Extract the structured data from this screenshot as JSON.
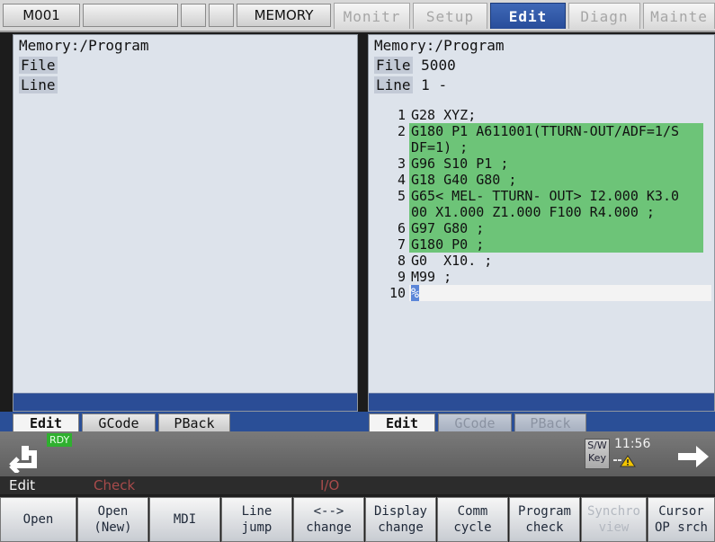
{
  "topbar": {
    "program_no": "M001",
    "mode_text": "MEMORY",
    "tabs": [
      {
        "label": "Monitr",
        "active": false
      },
      {
        "label": "Setup",
        "active": false
      },
      {
        "label": "Edit",
        "active": true
      },
      {
        "label": "Diagn",
        "active": false
      },
      {
        "label": "Mainte",
        "active": false
      }
    ]
  },
  "left_pane": {
    "path": "Memory:/Program",
    "file_label": "File",
    "file_value": "",
    "line_label": "Line",
    "line_value": ""
  },
  "right_pane": {
    "path": "Memory:/Program",
    "file_label": "File",
    "file_value": "5000",
    "line_label": "Line",
    "line_value": "1 -",
    "lines": [
      {
        "no": "1",
        "text": [
          "G28 XYZ;"
        ],
        "highlight": false
      },
      {
        "no": "2",
        "text": [
          "G180 P1 A611001(TTURN-OUT/ADF=1/S",
          "DF=1) ;"
        ],
        "highlight": true
      },
      {
        "no": "3",
        "text": [
          "G96 S10 P1 ;"
        ],
        "highlight": true
      },
      {
        "no": "4",
        "text": [
          "G18 G40 G80 ;"
        ],
        "highlight": true
      },
      {
        "no": "5",
        "text": [
          "G65< MEL- TTURN- OUT> I2.000 K3.0",
          "00 X1.000 Z1.000 F100 R4.000 ;"
        ],
        "highlight": true
      },
      {
        "no": "6",
        "text": [
          "G97 G80 ;"
        ],
        "highlight": true
      },
      {
        "no": "7",
        "text": [
          "G180 P0 ;"
        ],
        "highlight": true
      },
      {
        "no": "8",
        "text": [
          "G0  X10. ;"
        ],
        "highlight": false
      },
      {
        "no": "9",
        "text": [
          "M99 ;"
        ],
        "highlight": false
      },
      {
        "no": "10",
        "text": [
          "%"
        ],
        "highlight": false,
        "cursor": true
      }
    ]
  },
  "left_subtabs": [
    "Edit",
    "GCode",
    "PBack"
  ],
  "right_subtabs": [
    "Edit",
    "GCode",
    "PBack"
  ],
  "status": {
    "rdy": "RDY",
    "sw_key_top": "S/W",
    "sw_key_bottom": "Key",
    "clock": "11:56"
  },
  "mode_line": {
    "mode": "Edit",
    "check": "Check",
    "io": "I/O"
  },
  "menu": [
    {
      "label": "Open",
      "enabled": true
    },
    {
      "label": "Open\n(New)",
      "enabled": true
    },
    {
      "label": "MDI",
      "enabled": true
    },
    {
      "label": "Line\njump",
      "enabled": true
    },
    {
      "label": "<-->\nchange",
      "enabled": true
    },
    {
      "label": "Display\nchange",
      "enabled": true
    },
    {
      "label": "Comm\ncycle",
      "enabled": true
    },
    {
      "label": "Program\ncheck",
      "enabled": true
    },
    {
      "label": "Synchro\nview",
      "enabled": false
    },
    {
      "label": "Cursor\nOP srch",
      "enabled": true
    }
  ],
  "colors": {
    "accent": "#2b4d96",
    "highlight": "#6dc478",
    "rdy": "#2fb02f"
  }
}
